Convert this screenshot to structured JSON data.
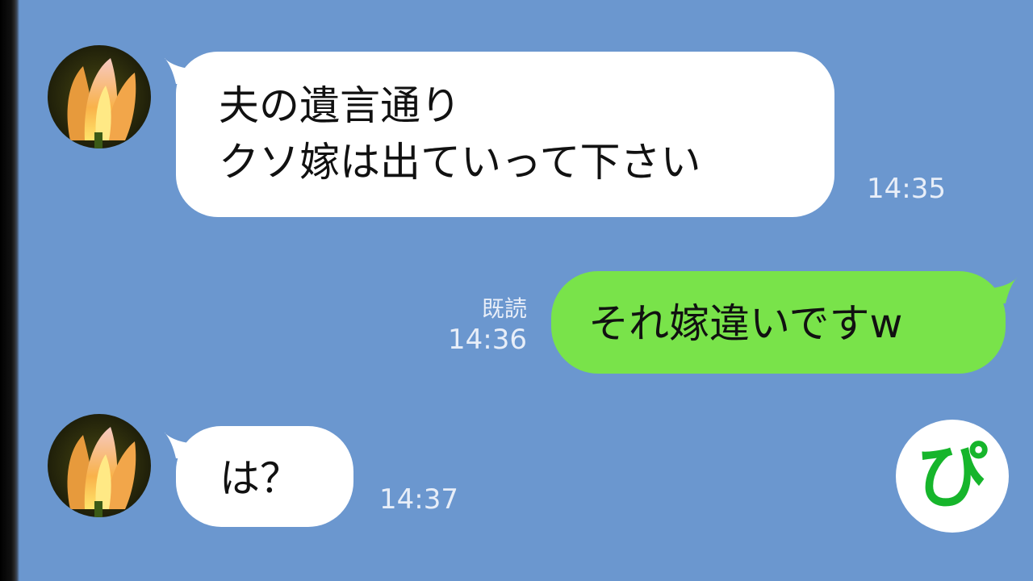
{
  "chat": {
    "messages": [
      {
        "direction": "incoming",
        "lines": [
          "夫の遺言通り",
          "クソ嫁は出ていって下さい"
        ],
        "time": "14:35"
      },
      {
        "direction": "outgoing",
        "lines": [
          "それ嫁違いですw"
        ],
        "read_label": "既読",
        "time": "14:36"
      },
      {
        "direction": "incoming",
        "lines": [
          "は？"
        ],
        "time": "14:37"
      }
    ]
  },
  "logo": {
    "text": "ぴ",
    "color": "#16b52b"
  },
  "colors": {
    "background": "#6b97cf",
    "incoming_bubble": "#ffffff",
    "outgoing_bubble": "#79e34a",
    "timestamp": "#e8eef8"
  },
  "icons": {
    "avatar": "tulip-flower-avatar",
    "logo": "pi-channel-logo"
  }
}
